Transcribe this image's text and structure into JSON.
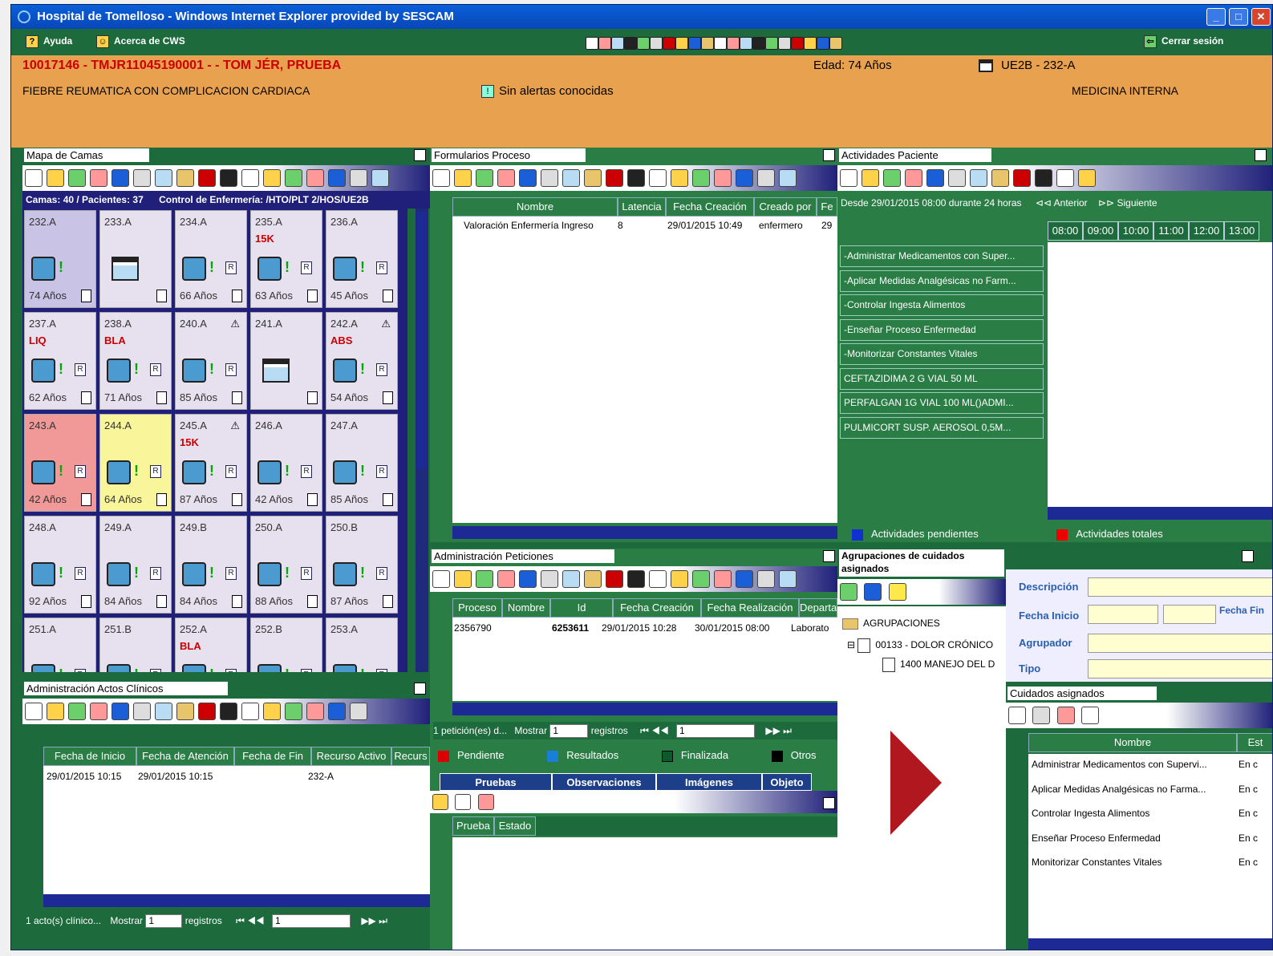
{
  "window": {
    "title": "Hospital de Tomelloso - Windows Internet Explorer provided by SESCAM"
  },
  "menu": {
    "help": "Ayuda",
    "about": "Acerca de CWS",
    "logout": "Cerrar sesión"
  },
  "patient": {
    "id_line": "10017146 - TMJR11045190001 - - TOM JÉR, PRUEBA",
    "age": "Edad: 74 Años",
    "bed": "UE2B - 232-A",
    "diagnosis": "FIEBRE REUMATICA CON COMPLICACION CARDIACA",
    "alerts": "Sin alertas conocidas",
    "service": "MEDICINA INTERNA"
  },
  "bedmap": {
    "title": "Mapa de Camas",
    "summary": "Camas: 40 / Pacientes: 37",
    "control": "Control de Enfermería: /HTO/PLT 2/HOS/UE2B",
    "beds": [
      {
        "name": "232.A",
        "flag": "",
        "warn": false,
        "state": "sel",
        "pat": true,
        "age": "74 Años"
      },
      {
        "name": "233.A",
        "flag": "",
        "warn": false,
        "state": "",
        "pat": false,
        "age": ""
      },
      {
        "name": "234.A",
        "flag": "",
        "warn": false,
        "state": "",
        "pat": true,
        "age": "66 Años"
      },
      {
        "name": "235.A",
        "flag": "15K",
        "warn": false,
        "state": "",
        "pat": true,
        "age": "63 Años"
      },
      {
        "name": "236.A",
        "flag": "",
        "warn": false,
        "state": "",
        "pat": true,
        "age": "45 Años"
      },
      {
        "name": "237.A",
        "flag": "LIQ",
        "warn": false,
        "state": "",
        "pat": true,
        "age": "62 Años"
      },
      {
        "name": "238.A",
        "flag": "BLA",
        "warn": false,
        "state": "",
        "pat": true,
        "age": "71 Años"
      },
      {
        "name": "240.A",
        "flag": "",
        "warn": true,
        "state": "",
        "pat": true,
        "age": "85 Años"
      },
      {
        "name": "241.A",
        "flag": "",
        "warn": false,
        "state": "",
        "pat": false,
        "age": ""
      },
      {
        "name": "242.A",
        "flag": "ABS",
        "warn": true,
        "state": "",
        "pat": true,
        "age": "54 Años"
      },
      {
        "name": "243.A",
        "flag": "",
        "warn": false,
        "state": "red",
        "pat": true,
        "age": "42 Años"
      },
      {
        "name": "244.A",
        "flag": "",
        "warn": false,
        "state": "yellow",
        "pat": true,
        "age": "64 Años"
      },
      {
        "name": "245.A",
        "flag": "15K",
        "warn": true,
        "state": "",
        "pat": true,
        "age": "87 Años"
      },
      {
        "name": "246.A",
        "flag": "",
        "warn": false,
        "state": "",
        "pat": true,
        "age": "42 Años"
      },
      {
        "name": "247.A",
        "flag": "",
        "warn": false,
        "state": "",
        "pat": true,
        "age": "85 Años"
      },
      {
        "name": "248.A",
        "flag": "",
        "warn": false,
        "state": "",
        "pat": true,
        "age": "92 Años"
      },
      {
        "name": "249.A",
        "flag": "",
        "warn": false,
        "state": "",
        "pat": true,
        "age": "84 Años"
      },
      {
        "name": "249.B",
        "flag": "",
        "warn": false,
        "state": "",
        "pat": true,
        "age": "84 Años"
      },
      {
        "name": "250.A",
        "flag": "",
        "warn": false,
        "state": "",
        "pat": true,
        "age": "88 Años"
      },
      {
        "name": "250.B",
        "flag": "",
        "warn": false,
        "state": "",
        "pat": true,
        "age": "87 Años"
      },
      {
        "name": "251.A",
        "flag": "",
        "warn": false,
        "state": "",
        "pat": true,
        "age": ""
      },
      {
        "name": "251.B",
        "flag": "",
        "warn": false,
        "state": "",
        "pat": true,
        "age": ""
      },
      {
        "name": "252.A",
        "flag": "BLA",
        "warn": false,
        "state": "",
        "pat": true,
        "age": ""
      },
      {
        "name": "252.B",
        "flag": "",
        "warn": false,
        "state": "",
        "pat": true,
        "age": ""
      },
      {
        "name": "253.A",
        "flag": "",
        "warn": false,
        "state": "",
        "pat": true,
        "age": ""
      }
    ]
  },
  "forms": {
    "title": "Formularios Proceso",
    "columns": [
      "Nombre",
      "Latencia",
      "Fecha Creación",
      "Creado por",
      "Fe"
    ],
    "rows": [
      {
        "name": "Valoración Enfermería Ingreso",
        "lat": "8",
        "date": "29/01/2015 10:49",
        "by": "enfermero",
        "fe": "29"
      }
    ]
  },
  "activities": {
    "title": "Actividades Paciente",
    "range": "Desde 29/01/2015 08:00 durante 24 horas",
    "prev": "Anterior",
    "next": "Siguiente",
    "hours": [
      "08:00",
      "09:00",
      "10:00",
      "11:00",
      "12:00",
      "13:00"
    ],
    "items": [
      "-Administrar Medicamentos con Super...",
      "-Aplicar Medidas Analgésicas no Farm...",
      "-Controlar Ingesta Alimentos",
      "-Enseñar Proceso Enfermedad",
      "-Monitorizar Constantes Vitales",
      "CEFTAZIDIMA 2 G VIAL 50 ML",
      "PERFALGAN 1G VIAL 100 ML()ADMI...",
      "PULMICORT SUSP. AEROSOL 0,5M..."
    ],
    "legend_pending": "Actividades pendientes",
    "legend_total": "Actividades totales"
  },
  "requests": {
    "title": "Administración Peticiones",
    "columns": [
      "Proceso",
      "Nombre",
      "Id",
      "Fecha Creación",
      "Fecha Realización",
      "Departan"
    ],
    "rows": [
      {
        "proceso": "2356790",
        "id": "6253611",
        "created": "29/01/2015 10:28",
        "done": "30/01/2015 08:00",
        "dept": "Laborato"
      }
    ],
    "footer_count": "1 petición(es) d...",
    "show": "Mostrar",
    "show_val": "1",
    "records": "registros",
    "page": "1",
    "legend": [
      "Pendiente",
      "Resultados",
      "Finalizada",
      "Otros"
    ],
    "tabs": [
      "Pruebas",
      "Observaciones",
      "Imágenes",
      "Objeto"
    ],
    "sub_columns": [
      "Prueba",
      "Estado"
    ]
  },
  "groupings": {
    "title": "Agrupaciones de cuidados asignados",
    "root": "AGRUPACIONES",
    "node1": "00133 - DOLOR CRÓNICO",
    "node2": "1400 MANEJO DEL D"
  },
  "search": {
    "desc": "Descripción",
    "start": "Fecha Inicio",
    "end": "Fecha Fin",
    "grouper": "Agrupador",
    "type": "Tipo"
  },
  "cares": {
    "title": "Cuidados asignados",
    "columns": [
      "Nombre",
      "Est"
    ],
    "rows": [
      {
        "name": "Administrar Medicamentos con Supervi...",
        "st": "En c"
      },
      {
        "name": "Aplicar Medidas Analgésicas no Farma...",
        "st": "En c"
      },
      {
        "name": "Controlar Ingesta Alimentos",
        "st": "En c"
      },
      {
        "name": "Enseñar Proceso Enfermedad",
        "st": "En c"
      },
      {
        "name": "Monitorizar Constantes Vitales",
        "st": "En c"
      }
    ]
  },
  "clinical": {
    "title": "Administración Actos Clínicos",
    "columns": [
      "Fecha de Inicio",
      "Fecha de Atención",
      "Fecha de Fin",
      "Recurso Activo",
      "Recurs"
    ],
    "rows": [
      {
        "start": "29/01/2015 10:15",
        "attn": "29/01/2015 10:15",
        "res": "232-A"
      }
    ],
    "footer_count": "1 acto(s) clínico...",
    "show": "Mostrar",
    "show_val": "1",
    "records": "registros",
    "page": "1"
  },
  "colors": {
    "green": "#2a7d44",
    "dark_green": "#1d6b3d",
    "navy": "#20207a",
    "orange": "#e8a14e",
    "red": "#c00000",
    "blue": "#1030d0"
  }
}
